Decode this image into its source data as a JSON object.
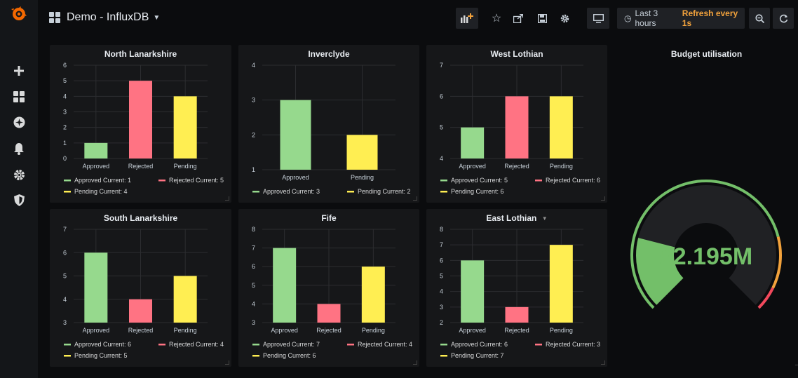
{
  "app": {
    "dashboard_title": "Demo - InfluxDB"
  },
  "toolbar": {
    "time_range": "Last 3 hours",
    "refresh": "Refresh every 1s"
  },
  "colors": {
    "approved": "#96d98d",
    "rejected": "#ff7383",
    "pending": "#ffee52",
    "gauge_green": "#73bf69",
    "gauge_orange": "#f2a23c",
    "gauge_red": "#f2495c"
  },
  "panels": [
    {
      "title": "North Lanarkshire",
      "yticks": [
        "0",
        "1",
        "2",
        "3",
        "4",
        "5",
        "6"
      ],
      "ymin": 0,
      "ymax": 6,
      "bars": [
        {
          "label": "Approved",
          "value": 1,
          "key": "approved"
        },
        {
          "label": "Rejected",
          "value": 5,
          "key": "rejected"
        },
        {
          "label": "Pending",
          "value": 4,
          "key": "pending"
        }
      ],
      "legend": [
        [
          "Approved  Current: 1",
          "Rejected  Current: 5"
        ],
        [
          "Pending  Current: 4"
        ]
      ]
    },
    {
      "title": "Inverclyde",
      "yticks": [
        "1",
        "2",
        "3",
        "4"
      ],
      "ymin": 1,
      "ymax": 4,
      "bars": [
        {
          "label": "Approved",
          "value": 3,
          "key": "approved"
        },
        {
          "label": "Pending",
          "value": 2,
          "key": "pending"
        }
      ],
      "legend": [
        [
          "Approved  Current: 3",
          "Pending  Current: 2"
        ]
      ]
    },
    {
      "title": "West Lothian",
      "yticks": [
        "4",
        "5",
        "6",
        "7"
      ],
      "ymin": 4,
      "ymax": 7,
      "bars": [
        {
          "label": "Approved",
          "value": 5,
          "key": "approved"
        },
        {
          "label": "Rejected",
          "value": 6,
          "key": "rejected"
        },
        {
          "label": "Pending",
          "value": 6,
          "key": "pending"
        }
      ],
      "legend": [
        [
          "Approved  Current: 5",
          "Rejected  Current: 6"
        ],
        [
          "Pending  Current: 6"
        ]
      ]
    },
    {
      "title": "South Lanarkshire",
      "yticks": [
        "3",
        "4",
        "5",
        "6",
        "7"
      ],
      "ymin": 3,
      "ymax": 7,
      "bars": [
        {
          "label": "Approved",
          "value": 6,
          "key": "approved"
        },
        {
          "label": "Rejected",
          "value": 4,
          "key": "rejected"
        },
        {
          "label": "Pending",
          "value": 5,
          "key": "pending"
        }
      ],
      "legend": [
        [
          "Approved  Current: 6",
          "Rejected  Current: 4"
        ],
        [
          "Pending  Current: 5"
        ]
      ]
    },
    {
      "title": "Fife",
      "yticks": [
        "3",
        "4",
        "5",
        "6",
        "7",
        "8"
      ],
      "ymin": 3,
      "ymax": 8,
      "bars": [
        {
          "label": "Approved",
          "value": 7,
          "key": "approved"
        },
        {
          "label": "Rejected",
          "value": 4,
          "key": "rejected"
        },
        {
          "label": "Pending",
          "value": 6,
          "key": "pending"
        }
      ],
      "legend": [
        [
          "Approved  Current: 7",
          "Rejected  Current: 4"
        ],
        [
          "Pending  Current: 6"
        ]
      ]
    },
    {
      "title": "East Lothian",
      "yticks": [
        "2",
        "3",
        "4",
        "5",
        "6",
        "7",
        "8"
      ],
      "ymin": 2,
      "ymax": 8,
      "has_menu": true,
      "bars": [
        {
          "label": "Approved",
          "value": 6,
          "key": "approved"
        },
        {
          "label": "Rejected",
          "value": 3,
          "key": "rejected"
        },
        {
          "label": "Pending",
          "value": 7,
          "key": "pending"
        }
      ],
      "legend": [
        [
          "Approved  Current: 6",
          "Rejected  Current: 3"
        ],
        [
          "Pending  Current: 7"
        ]
      ]
    }
  ],
  "gauge": {
    "title": "Budget utilisation",
    "value_text": "£2.195M",
    "fill_fraction": 0.22
  },
  "sidebar_icons": [
    "grafana-logo-icon",
    "plus-icon",
    "dashboards-icon",
    "explore-icon",
    "alerting-icon",
    "configuration-icon",
    "shield-icon"
  ]
}
